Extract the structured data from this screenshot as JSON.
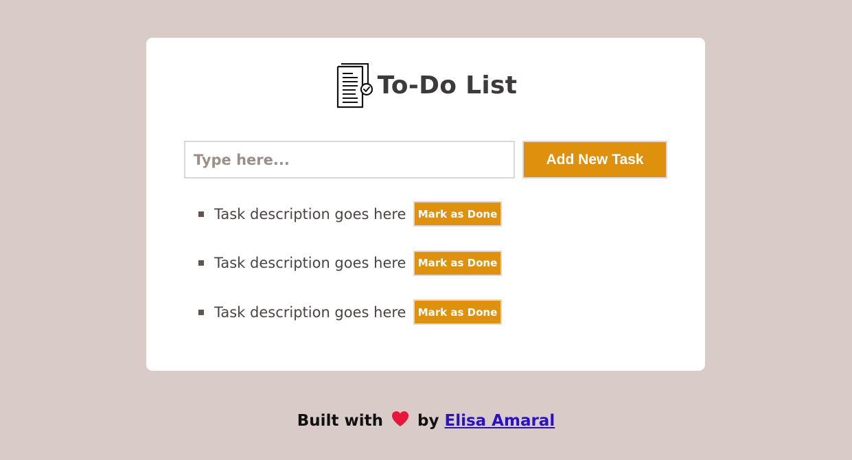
{
  "app": {
    "title": "To-Do List",
    "logo_icon": "checklist-document-icon"
  },
  "input": {
    "placeholder": "Type here...",
    "value": ""
  },
  "add_button": {
    "label": "Add New Task"
  },
  "tasks": [
    {
      "text": "Task description goes here",
      "button_label": "Mark as Done"
    },
    {
      "text": "Task description goes here",
      "button_label": "Mark as Done"
    },
    {
      "text": "Task description goes here",
      "button_label": "Mark as Done"
    }
  ],
  "footer": {
    "prefix": "Built with",
    "heart_icon": "heart-icon",
    "by": "by",
    "author": "Elisa Amaral"
  },
  "colors": {
    "background": "#d9ccc8",
    "card": "#ffffff",
    "accent": "#dd910c",
    "heading": "#3d3a39",
    "heart": "#e8153f",
    "link": "#2a12c4"
  }
}
